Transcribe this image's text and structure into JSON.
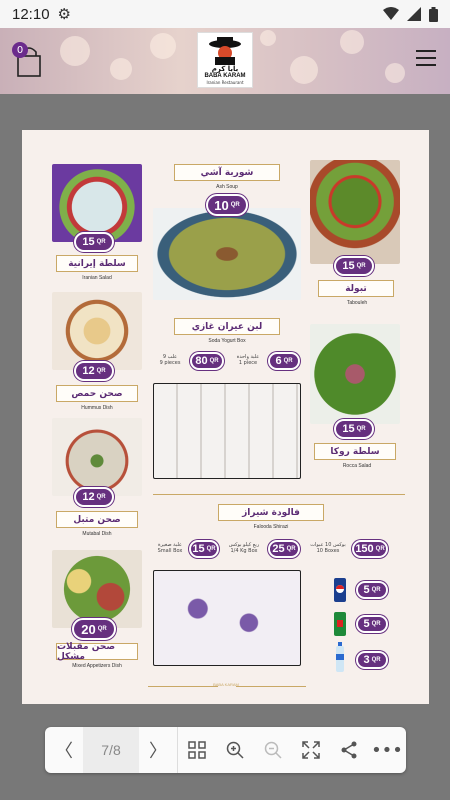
{
  "status": {
    "time": "12:10"
  },
  "header": {
    "cart_count": "0",
    "logo_arabic": "بابا كرم",
    "logo_english": "BABA KARAM",
    "logo_sub": "Iranian Restaurant"
  },
  "menu": {
    "currency": "QR",
    "items": [
      {
        "ar": "سلطة إيرانية",
        "en": "Iranian Salad",
        "price": "15"
      },
      {
        "ar": "شوربة آشي",
        "en": "Ash Soup",
        "price": "10"
      },
      {
        "ar": "تبولة",
        "en": "Tabouleh",
        "price": "15"
      },
      {
        "ar": "صحن حمص",
        "en": "Hummus Dish",
        "price": "12"
      },
      {
        "ar": "لبن عيران غازي",
        "en": "Soda Yogurt Box"
      },
      {
        "ar": "سلطة روكا",
        "en": "Rocca Salad",
        "price": "15"
      },
      {
        "ar": "صحن متبل",
        "en": "Mutabal Dish",
        "price": "12"
      },
      {
        "ar": "فالودة شيراز",
        "en": "Falooda Shirazi"
      },
      {
        "ar": "صحن مقبلات مشكل",
        "en": "Mixed Appetizers Dish",
        "price": "20"
      }
    ],
    "yogurt_options": [
      {
        "ar": "9 علب",
        "en": "9 pieces",
        "price": "80"
      },
      {
        "ar": "علبة واحدة",
        "en": "1 piece",
        "price": "6"
      }
    ],
    "falooda_options": [
      {
        "ar": "علبة صغيرة",
        "en": "Small Box",
        "price": "15"
      },
      {
        "ar": "ربع كيلو بوكس",
        "en": "1/4 Kg Box",
        "price": "25"
      },
      {
        "ar": "بوكس 10 عبوات",
        "en": "10 Boxes",
        "price": "150"
      }
    ],
    "drinks": [
      {
        "price": "5"
      },
      {
        "price": "5"
      },
      {
        "price": "3"
      }
    ],
    "footer": "BABA KARAM"
  },
  "toolbar": {
    "page_indicator": "7/8"
  }
}
